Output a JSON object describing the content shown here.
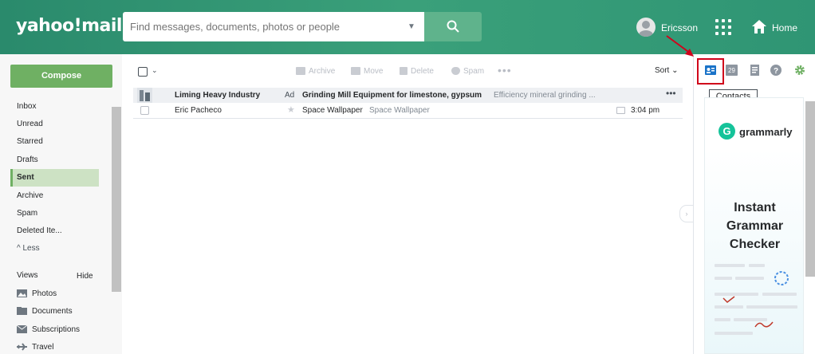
{
  "header": {
    "logo": "yahoo!mail",
    "search_placeholder": "Find messages, documents, photos or people",
    "user_name": "Ericsson",
    "home_label": "Home"
  },
  "sidebar": {
    "compose_label": "Compose",
    "folders": [
      {
        "label": "Inbox",
        "active": false
      },
      {
        "label": "Unread",
        "active": false
      },
      {
        "label": "Starred",
        "active": false
      },
      {
        "label": "Drafts",
        "active": false
      },
      {
        "label": "Sent",
        "active": true
      },
      {
        "label": "Archive",
        "active": false
      },
      {
        "label": "Spam",
        "active": false
      },
      {
        "label": "Deleted Ite...",
        "active": false
      }
    ],
    "less_label": "^ Less",
    "views_label": "Views",
    "hide_label": "Hide",
    "views": [
      {
        "label": "Photos",
        "icon": "photo-icon"
      },
      {
        "label": "Documents",
        "icon": "document-icon"
      },
      {
        "label": "Subscriptions",
        "icon": "subscriptions-icon"
      },
      {
        "label": "Travel",
        "icon": "plane-icon"
      }
    ]
  },
  "toolbar": {
    "archive_label": "Archive",
    "move_label": "Move",
    "delete_label": "Delete",
    "spam_label": "Spam",
    "more_label": "•••",
    "sort_label": "Sort"
  },
  "messages": [
    {
      "type": "ad",
      "sender": "Liming Heavy Industry",
      "ad_label": "Ad",
      "subject": "Grinding Mill Equipment for limestone, gypsum",
      "snippet": "Efficiency mineral grinding ...",
      "more": "•••"
    },
    {
      "type": "normal",
      "sender": "Eric Pacheco",
      "subject": "Space Wallpaper",
      "snippet": "Space Wallpaper",
      "time": "3:04 pm"
    }
  ],
  "rail": {
    "calendar_day": "29",
    "tooltip": "Contacts"
  },
  "ad_panel": {
    "brand": "grammarly",
    "headline": "Instant Grammar Checker"
  },
  "colors": {
    "header": "#2f9574",
    "compose": "#6fb063",
    "highlight": "#d0021b"
  }
}
